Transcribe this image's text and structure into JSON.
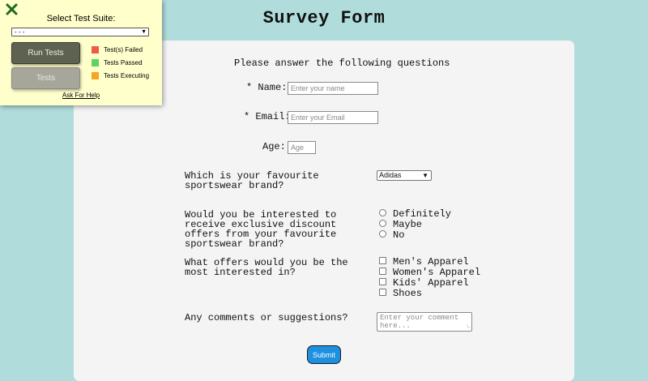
{
  "page": {
    "title": "Survey Form",
    "intro": "Please answer the following questions"
  },
  "fields": {
    "name": {
      "label": "* Name:",
      "placeholder": "Enter your name"
    },
    "email": {
      "label": "* Email:",
      "placeholder": "Enter your Email"
    },
    "age": {
      "label": "Age:",
      "placeholder": "Age"
    }
  },
  "questions": {
    "brand": {
      "label": "Which is your favourite sportswear brand?",
      "selected": "Adidas"
    },
    "discount": {
      "label": "Would you be interested to receive exclusive discount offers from your favourite sportswear brand?",
      "options": [
        "Definitely",
        "Maybe",
        "No"
      ]
    },
    "offers": {
      "label": "What offers would you be the most interested in?",
      "options": [
        "Men's Apparel",
        "Women's Apparel",
        "Kids' Apparel",
        "Shoes"
      ]
    },
    "comments": {
      "label": "Any comments or suggestions?",
      "placeholder": "Enter your comment here..."
    }
  },
  "submit_label": "Submit",
  "test_panel": {
    "heading": "Select Test Suite:",
    "suite_selected": "- - -",
    "run_label": "Run Tests",
    "tests_label": "Tests",
    "legend": [
      {
        "label": "Test(s) Failed",
        "color": "#f05a47"
      },
      {
        "label": "Tests Passed",
        "color": "#5fd35f"
      },
      {
        "label": "Tests Executing",
        "color": "#f5a623"
      }
    ],
    "help_label": "Ask For Help"
  },
  "colors": {
    "background": "#b1dcdc",
    "card": "#f4f4f4",
    "submit": "#1e90e0",
    "panel": "#ffffcc",
    "close_icon": "#1a6b1a"
  }
}
